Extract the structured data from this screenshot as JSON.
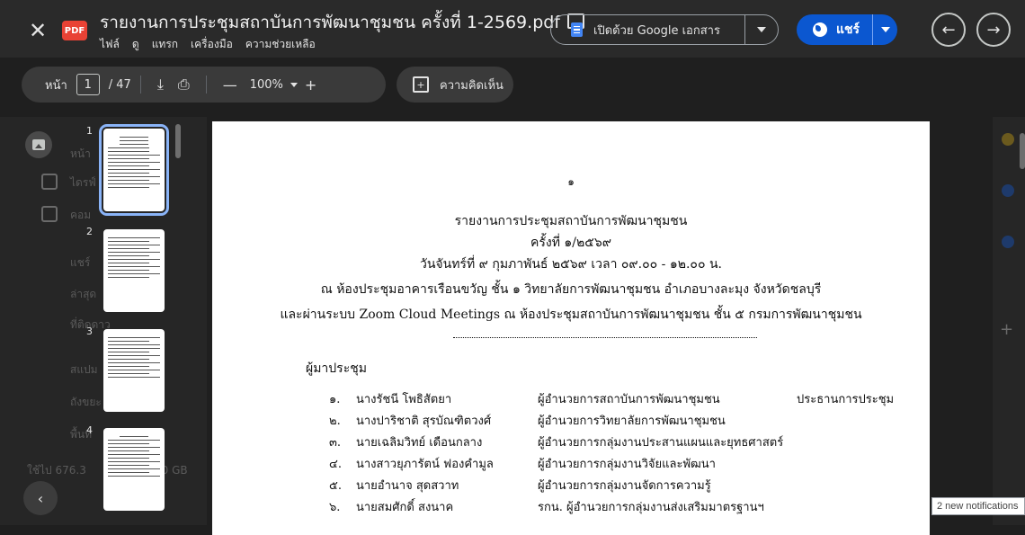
{
  "header": {
    "title": "รายงานการประชุมสถาบันการพัฒนาชุมชน ครั้งที่ 1-2569.pdf",
    "file_badge": "PDF",
    "menu": [
      "ไฟล์",
      "ดู",
      "แทรก",
      "เครื่องมือ",
      "ความช่วยเหลือ"
    ],
    "open_with_label": "เปิดด้วย Google เอกสาร",
    "share_label": "แชร์"
  },
  "toolbar": {
    "page_label": "หน้า",
    "current_page": "1",
    "total_pages": "/ 47",
    "zoom": "100%",
    "comment_label": "ความคิดเห็น"
  },
  "thumbnails": [
    "1",
    "2",
    "3",
    "4"
  ],
  "background": {
    "drive_items": [
      "หน้า",
      "ไดรฟ์",
      "คอม",
      "แชร์",
      "ล่าสุด",
      "ที่ติดดาว",
      "สแปม",
      "ถังขยะ",
      "พื้นที่"
    ],
    "storage": "ใช้ไป 676.3",
    "storage_total": "0 GB"
  },
  "document": {
    "page_number": "๑",
    "heading": [
      "รายงานการประชุมสถาบันการพัฒนาชุมชน",
      "ครั้งที่ ๑/๒๕๖๙",
      "วันจันทร์ที่ ๙ กุมภาพันธ์ ๒๕๖๙ เวลา ๐๙.๐๐ - ๑๒.๐๐ น.",
      "ณ ห้องประชุมอาคารเรือนขวัญ ชั้น ๑ วิทยาลัยการพัฒนาชุมชน อำเภอบางละมุง จังหวัดชลบุรี",
      "และผ่านระบบ Zoom Cloud Meetings ณ ห้องประชุมสถาบันการพัฒนาชุมชน ชั้น ๕ กรมการพัฒนาชุมชน"
    ],
    "attendees_heading": "ผู้มาประชุม",
    "attendees": [
      {
        "no": "๑.",
        "name": "นางรัชนี โพธิสัตยา",
        "position": "ผู้อำนวยการสถาบันการพัฒนาชุมชน",
        "role": "ประธานการประชุม"
      },
      {
        "no": "๒.",
        "name": "นางปาริชาติ สุรบัณฑิตวงศ์",
        "position": "ผู้อำนวยการวิทยาลัยการพัฒนาชุมชน",
        "role": ""
      },
      {
        "no": "๓.",
        "name": "นายเฉลิมวิทย์ เดือนกลาง",
        "position": "ผู้อำนวยการกลุ่มงานประสานแผนและยุทธศาสตร์",
        "role": ""
      },
      {
        "no": "๔.",
        "name": "นางสาวยุภารัตน์ ฟองคำมูล",
        "position": "ผู้อำนวยการกลุ่มงานวิจัยและพัฒนา",
        "role": ""
      },
      {
        "no": "๕.",
        "name": "นายอำนาจ สุดสวาท",
        "position": "ผู้อำนวยการกลุ่มงานจัดการความรู้",
        "role": ""
      },
      {
        "no": "๖.",
        "name": "นายสมศักดิ์ สงนาค",
        "position": "รกน. ผู้อำนวยการกลุ่มงานส่งเสริมมาตรฐานฯ",
        "role": ""
      }
    ]
  },
  "notification": "2 new notifications",
  "colors": {
    "accent": "#0b57d0",
    "pdf_badge": "#e94235",
    "thumb_highlight": "#8ab4f8"
  }
}
